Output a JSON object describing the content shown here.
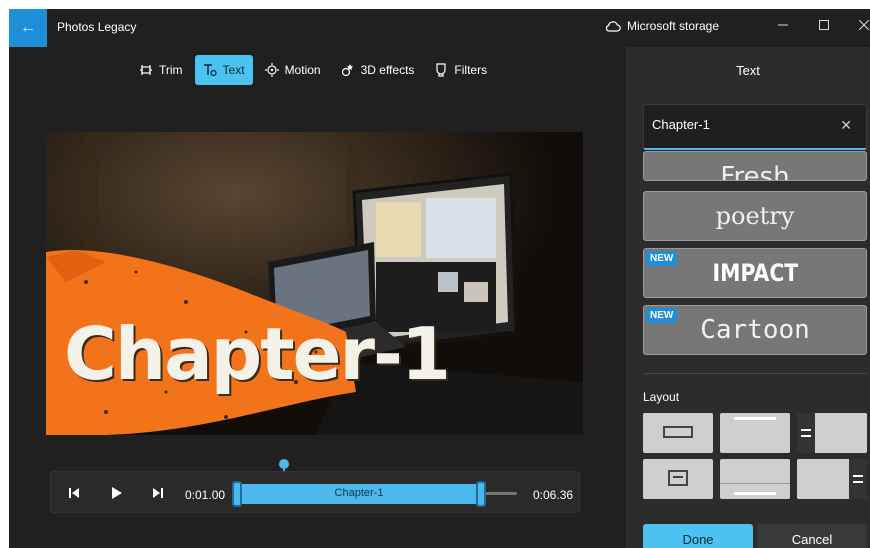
{
  "titlebar": {
    "app_title": "Photos Legacy",
    "storage_label": "Microsoft storage",
    "back_icon": "arrow-left-icon",
    "storage_icon": "cloud-icon",
    "accent": "#1e8fd6"
  },
  "toolbar": {
    "tools": [
      {
        "label": "Trim",
        "icon": "trim-icon",
        "active": false
      },
      {
        "label": "Text",
        "icon": "text-icon",
        "active": true
      },
      {
        "label": "Motion",
        "icon": "motion-icon",
        "active": false
      },
      {
        "label": "3D effects",
        "icon": "3d-effects-icon",
        "active": false
      },
      {
        "label": "Filters",
        "icon": "filters-icon",
        "active": false
      }
    ]
  },
  "preview": {
    "overlay_text": "Chapter-1"
  },
  "timeline": {
    "current_time": "0:01.00",
    "end_time": "0:06.36",
    "clip_label": "Chapter-1"
  },
  "panel": {
    "title": "Text",
    "input_value": "Chapter-1",
    "styles": [
      {
        "label": "Fresh",
        "new": false
      },
      {
        "label": "poetry",
        "new": false
      },
      {
        "label": "IMPACT",
        "new": true
      },
      {
        "label": "Cartoon",
        "new": true
      }
    ],
    "new_badge": "NEW",
    "layout_label": "Layout",
    "done_label": "Done",
    "cancel_label": "Cancel",
    "accent": "#4cc2f1"
  }
}
